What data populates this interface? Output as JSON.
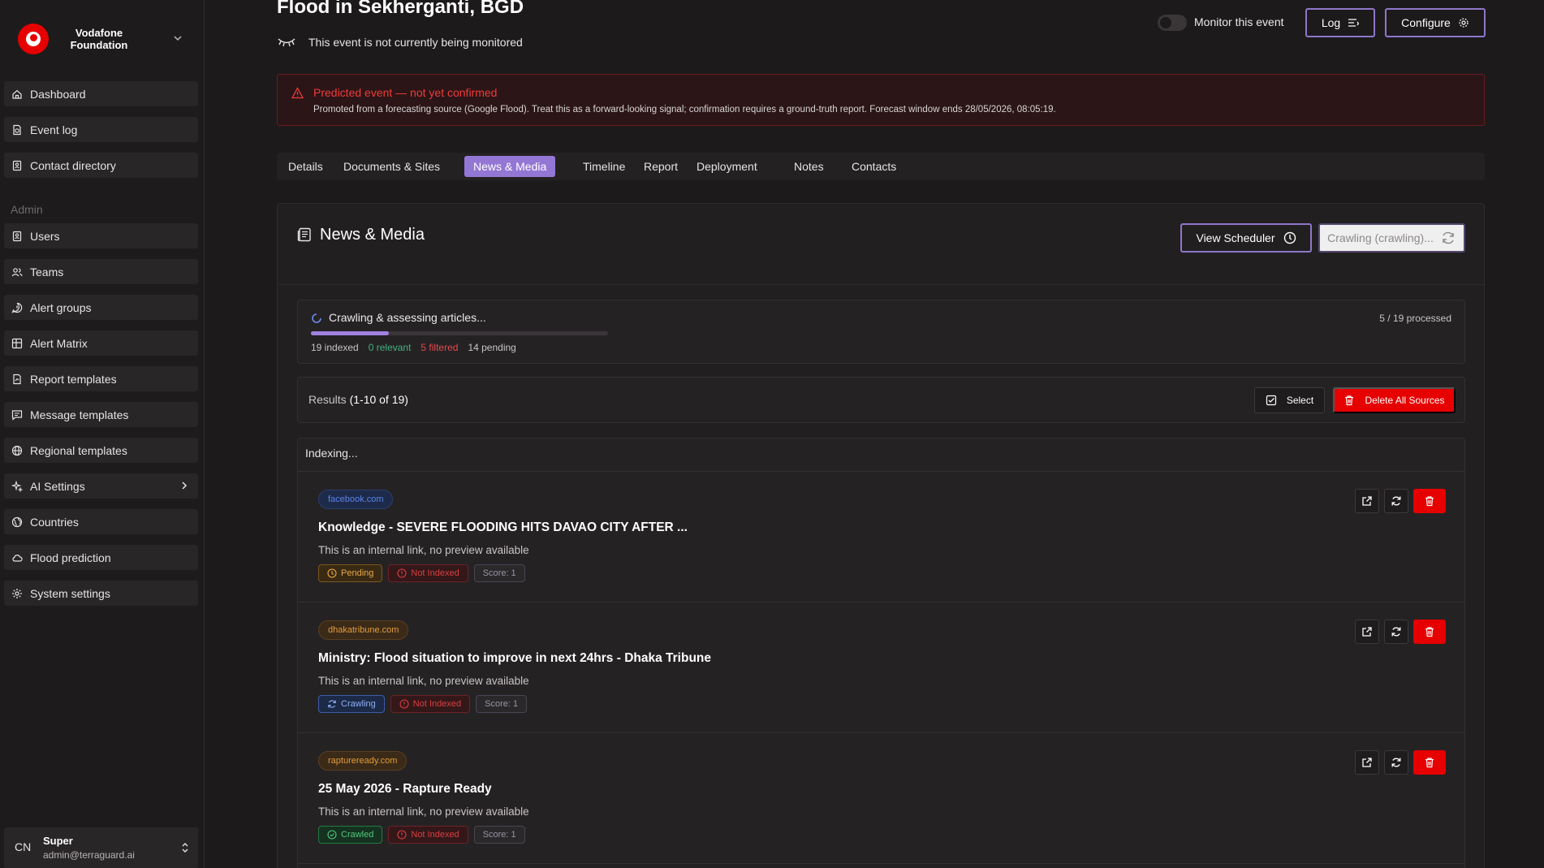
{
  "brand": {
    "name": "Vodafone Foundation"
  },
  "sidebar": {
    "items": [
      {
        "label": "Dashboard",
        "icon": "home-icon"
      },
      {
        "label": "Event log",
        "icon": "event-log-icon"
      },
      {
        "label": "Contact directory",
        "icon": "contact-icon"
      }
    ],
    "admin_label": "Admin",
    "admin_items": [
      {
        "label": "Users",
        "icon": "users-icon"
      },
      {
        "label": "Teams",
        "icon": "teams-icon"
      },
      {
        "label": "Alert groups",
        "icon": "alert-groups-icon"
      },
      {
        "label": "Alert Matrix",
        "icon": "matrix-icon"
      },
      {
        "label": "Report templates",
        "icon": "report-icon"
      },
      {
        "label": "Message templates",
        "icon": "message-icon"
      },
      {
        "label": "Regional templates",
        "icon": "globe-icon"
      },
      {
        "label": "AI Settings",
        "icon": "sparkles-icon"
      },
      {
        "label": "Countries",
        "icon": "countries-icon"
      },
      {
        "label": "Flood prediction",
        "icon": "cloud-icon"
      },
      {
        "label": "System settings",
        "icon": "gear-icon"
      }
    ],
    "user": {
      "initials": "CN",
      "name": "Super",
      "email": "admin@terraguard.ai"
    }
  },
  "header": {
    "title": "Flood in Sekherganti, BGD",
    "monitor_status": "This event is not currently being monitored",
    "monitor_label": "Monitor this event",
    "log_label": "Log",
    "configure_label": "Configure"
  },
  "alert": {
    "title": "Predicted event — not yet confirmed",
    "body": "Promoted from a forecasting source (Google Flood). Treat this as a forward-looking signal; confirmation requires a ground-truth report. Forecast window ends 28/05/2026, 08:05:19."
  },
  "tabs": [
    "Details",
    "Documents & Sites",
    "News & Media",
    "Timeline",
    "Report",
    "Deployment",
    "Notes",
    "Contacts"
  ],
  "panel": {
    "title": "News & Media",
    "view_scheduler_label": "View Scheduler",
    "crawling_label": "Crawling (crawling)..."
  },
  "progress": {
    "label": "Crawling & assessing articles...",
    "processed": "5 / 19 processed",
    "fraction": 0.263,
    "indexed": "19 indexed",
    "relevant": "0 relevant",
    "filtered": "5 filtered",
    "pending": "14 pending",
    "colors": {
      "relevant": "#3fb27f",
      "filtered": "#e5484d",
      "fill": "#a082e0"
    }
  },
  "results": {
    "label": "Results",
    "range": "(1-10 of 19)",
    "select_label": "Select",
    "delete_all_label": "Delete All Sources"
  },
  "list": {
    "indexing_label": "Indexing...",
    "articles": [
      {
        "domain": "facebook.com",
        "title": "Knowledge - SEVERE FLOODING HITS DAVAO CITY AFTER ...",
        "desc": "This is an internal link, no preview available",
        "status": "Pending",
        "index_status": "Not Indexed",
        "score": "Score: 1"
      },
      {
        "domain": "dhakatribune.com",
        "title": "Ministry: Flood situation to improve in next 24hrs - Dhaka Tribune",
        "desc": "This is an internal link, no preview available",
        "status": "Crawling",
        "index_status": "Not Indexed",
        "score": "Score: 1"
      },
      {
        "domain": "raptureready.com",
        "title": "25 May 2026 - Rapture Ready",
        "desc": "This is an internal link, no preview available",
        "status": "Crawled",
        "index_status": "Not Indexed",
        "score": "Score: 1"
      }
    ]
  },
  "colors": {
    "accent": "#9477d4",
    "danger": "#e60000",
    "brand": "#e60000"
  }
}
